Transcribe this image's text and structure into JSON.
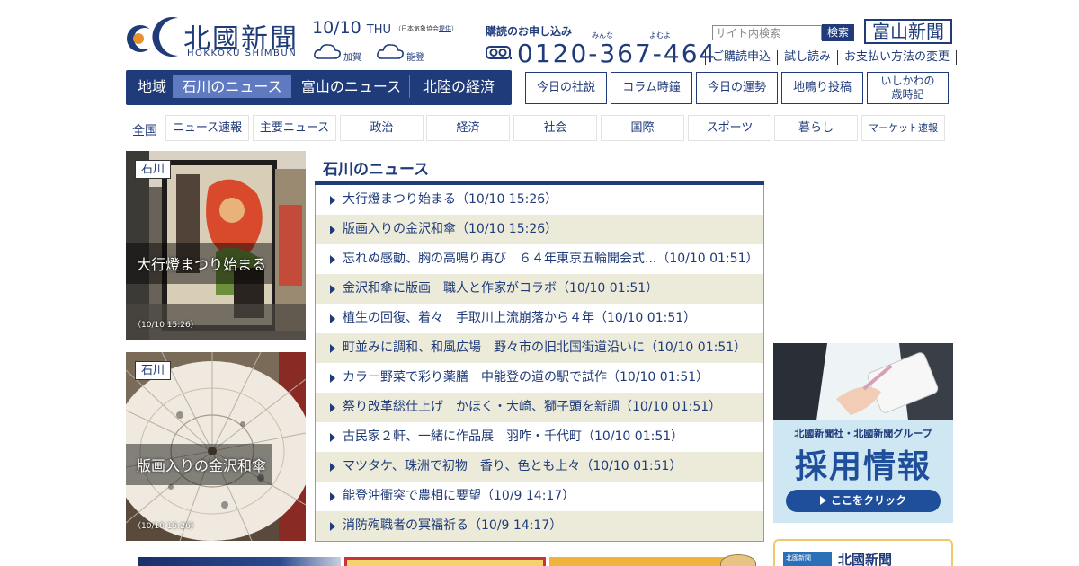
{
  "colors": {
    "brand": "#1f3b7a",
    "active_tab": "#5f7ac0",
    "row_alt": "#ecebd9"
  },
  "header": {
    "logo_title": "北國新聞",
    "logo_sub": "HOKKOKU SHIMBUN",
    "date": "10/10",
    "day_of_week": "THU",
    "weather_note_prefix": "（日本気象協会",
    "weather_note_link": "提供",
    "weather_note_suffix": "）",
    "weather": [
      {
        "icon": "cloud-icon",
        "label": "加賀"
      },
      {
        "icon": "cloud-icon",
        "label": "能登"
      }
    ],
    "subscribe_label": "購読のお申し込み",
    "phone_ruby_1": "みんな",
    "phone_ruby_2": "よむよ",
    "phone_number": "0120-367-464",
    "search_placeholder": "サイト内検索",
    "search_button": "検索",
    "toyama_logo": "富山新聞",
    "sub_links": [
      "ご購読申込",
      "試し読み",
      "お支払い方法の変更"
    ]
  },
  "region_nav": {
    "label": "地域",
    "tabs": [
      "石川のニュース",
      "富山のニュース",
      "北陸の経済"
    ],
    "active": "石川のニュース"
  },
  "column_buttons": [
    "今日の社説",
    "コラム時鐘",
    "今日の運勢",
    "地鳴り投稿",
    "いしかわの\n歳時記"
  ],
  "column_button_5_line1": "いしかわの",
  "column_button_5_line2": "歳時記",
  "category_nav": {
    "label": "全国",
    "items": [
      "ニュース速報",
      "主要ニュース",
      "政治",
      "経済",
      "社会",
      "国際",
      "スポーツ",
      "暮らし",
      "マーケット速報"
    ]
  },
  "features": [
    {
      "tag": "石川",
      "caption": "大行燈まつり始まる",
      "time": "（10/10 15:26）"
    },
    {
      "tag": "石川",
      "caption": "版画入りの金沢和傘",
      "time": "（10/10 15:26）"
    }
  ],
  "news": {
    "title": "石川のニュース",
    "items": [
      "大行燈まつり始まる（10/10 15:26）",
      "版画入りの金沢和傘（10/10 15:26）",
      "忘れぬ感動、胸の高鳴り再び　６４年東京五輪開会式...（10/10 01:51）",
      "金沢和傘に版画　職人と作家がコラボ（10/10 01:51）",
      "植生の回復、着々　手取川上流崩落から４年（10/10 01:51）",
      "町並みに調和、和風広場　野々市の旧北国街道沿いに（10/10 01:51）",
      "カラー野菜で彩り薬膳　中能登の道の駅で試作（10/10 01:51）",
      "祭り改革総仕上げ　かほく・大崎、獅子頭を新調（10/10 01:51）",
      "古民家２軒、一緒に作品展　羽咋・千代町（10/10 01:51）",
      "マツタケ、珠洲で初物　香り、色とも上々（10/10 01:51）",
      "能登沖衝突で農相に要望（10/9 14:17）",
      "消防殉職者の冥福祈る（10/9 14:17）"
    ]
  },
  "ad": {
    "line1": "北國新聞社・北國新聞グループ",
    "line2": "採用情報",
    "button": "ここをクリック"
  },
  "paper_box": {
    "label": "北國新聞",
    "thumb": "北國新聞"
  }
}
